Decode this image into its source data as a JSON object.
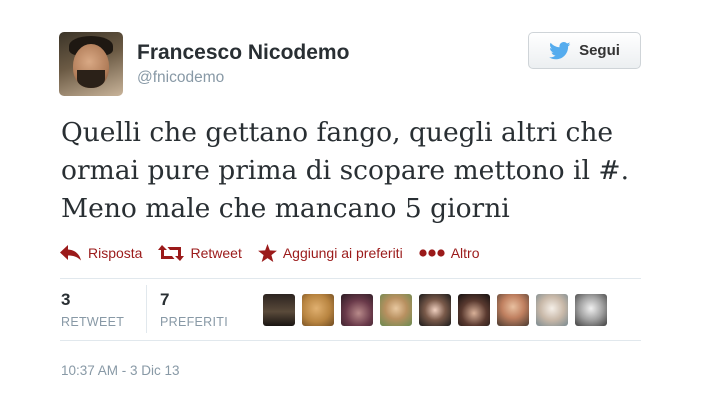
{
  "user": {
    "full_name": "Francesco Nicodemo",
    "username": "@fnicodemo",
    "avatar_icon": "user-avatar-photo"
  },
  "follow_button": {
    "label": "Segui",
    "icon": "twitter-bird-icon",
    "icon_color": "#55acee"
  },
  "tweet": {
    "lines": [
      "Quelli che gettano fango, quegli altri che",
      "ormai pure prima di scopare mettono il #.",
      "Meno male che mancano 5 giorni"
    ]
  },
  "actions": {
    "color": "#9b1a1a",
    "reply": {
      "label": "Risposta",
      "icon": "reply-arrow-icon"
    },
    "retweet": {
      "label": "Retweet",
      "icon": "retweet-icon"
    },
    "favorite": {
      "label": "Aggiungi ai preferiti",
      "icon": "star-icon"
    },
    "more": {
      "label": "Altro",
      "icon": "more-dots-icon"
    }
  },
  "stats": {
    "retweets": {
      "count": "3",
      "label": "RETWEET"
    },
    "favorites": {
      "count": "7",
      "label": "PREFERITI"
    }
  },
  "favorited_by_count": 9,
  "timestamp": "10:37 AM - 3 Dic 13"
}
